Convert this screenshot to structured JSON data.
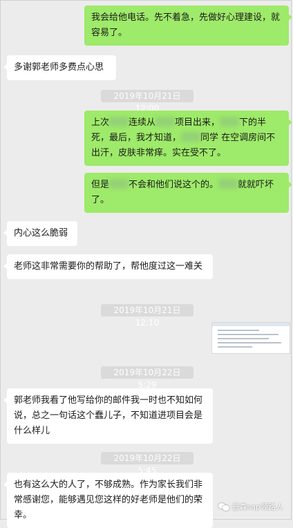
{
  "messages": [
    {
      "text": "我会给他电话。先不着急，先做好心理建设，就容易了。"
    },
    {
      "text": "多谢郭老师多费点心思"
    },
    {
      "time": "2019年10月21日 12:00"
    },
    {
      "text_parts": [
        "上次",
        "连续从",
        "项目出来，",
        "下的半死，最后，我才知道，",
        "同学 在空调房间不出汗，皮肤非常痒。实在受不了。"
      ]
    },
    {
      "text_parts": [
        "但是",
        "不会和他们说这个的。",
        "就就吓坏了。"
      ]
    },
    {
      "text": "内心这么脆弱"
    },
    {
      "text": "老师这非常需要你的帮助了，帮他度过这一难关"
    },
    {
      "time": "2019年10月21日 12:10"
    },
    {
      "time": "2019年10月22日 5:29"
    },
    {
      "text": "郭老师我看了他写给你的邮件我一时也不知如何说，总之一句话这个蠢儿子，不知道进项目会是什么样儿"
    },
    {
      "time": "2019年10月22日 5:45"
    },
    {
      "text": "也有这么大的人了，不够成熟。作为家长我们非常感谢您，能够遇见您这样的好老师是他们的荣幸。"
    }
  ],
  "watermark": "普森sap领路人",
  "colors": {
    "outgoing": "#9eea6a",
    "incoming": "#ffffff",
    "background": "#ececec",
    "time_badge": "#dadada"
  }
}
